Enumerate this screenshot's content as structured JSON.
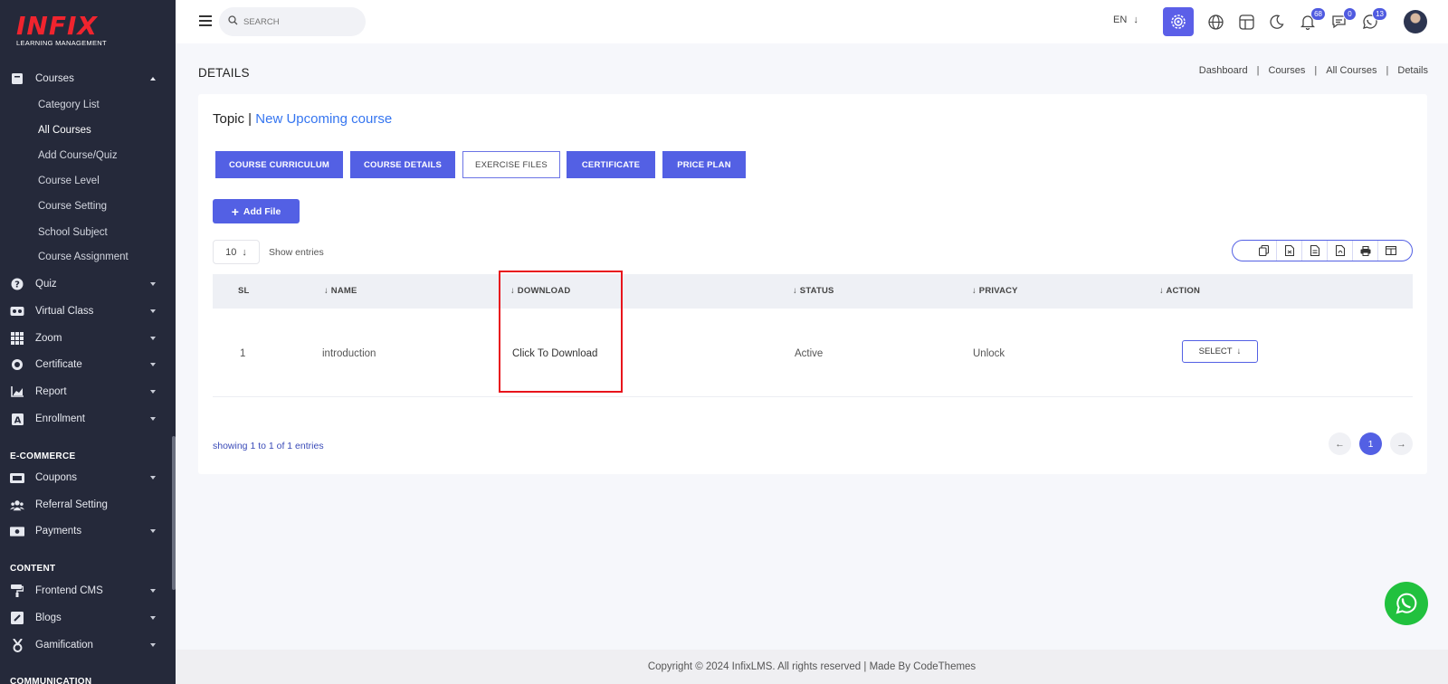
{
  "sidebar": {
    "logo_text": "INFIX",
    "logo_subtitle": "LEARNING MANAGEMENT",
    "courses_label": "Courses",
    "sub_items": [
      "Category List",
      "All Courses",
      "Add Course/Quiz",
      "Course Level",
      "Course Setting",
      "School Subject",
      "Course Assignment"
    ],
    "active_sub_item": "All Courses",
    "items": [
      "Quiz",
      "Virtual Class",
      "Zoom",
      "Certificate",
      "Report",
      "Enrollment"
    ],
    "section_ecommerce": "E-COMMERCE",
    "ecommerce_items": [
      "Coupons",
      "Referral Setting",
      "Payments"
    ],
    "section_content": "CONTENT",
    "content_items": [
      "Frontend CMS",
      "Blogs",
      "Gamification"
    ],
    "section_communication": "COMMUNICATION"
  },
  "topbar": {
    "search_placeholder": "SEARCH",
    "language": "EN",
    "notifications_count": "68",
    "messages_count": "0",
    "chat_count": "13",
    "icons": [
      "settings-icon",
      "globe-icon",
      "layout-icon",
      "moon-icon",
      "bell-icon",
      "message-icon",
      "whatsapp-icon"
    ]
  },
  "page": {
    "title": "DETAILS",
    "breadcrumb": [
      "Dashboard",
      "Courses",
      "All Courses",
      "Details"
    ]
  },
  "card": {
    "topic_label": "Topic |",
    "topic_link": "New Upcoming course",
    "tabs": [
      "COURSE CURRICULUM",
      "COURSE DETAILS",
      "EXERCISE FILES",
      "CERTIFICATE",
      "PRICE PLAN"
    ],
    "active_tab": "EXERCISE FILES",
    "add_file_label": "Add File",
    "entries_value": "10",
    "entries_label": "Show entries",
    "export_icons": [
      "copy-icon",
      "csv-icon",
      "excel-icon",
      "pdf-icon",
      "print-icon",
      "columns-icon"
    ]
  },
  "table": {
    "headers": [
      "SL",
      "NAME",
      "DOWNLOAD",
      "STATUS",
      "PRIVACY",
      "ACTION"
    ],
    "rows": [
      {
        "sl": "1",
        "name": "introduction",
        "download": "Click To Download",
        "status": "Active",
        "privacy": "Unlock",
        "action": "SELECT"
      }
    ],
    "showing_text": "showing 1 to 1 of 1 entries",
    "current_page": "1"
  },
  "footer": {
    "text": "Copyright © 2024 InfixLMS. All rights reserved | Made By CodeThemes"
  },
  "colors": {
    "sidebar_bg": "#25293a",
    "primary": "#5360e4",
    "link": "#3575f0",
    "highlight": "#e8141c",
    "whatsapp": "#21c13e"
  }
}
